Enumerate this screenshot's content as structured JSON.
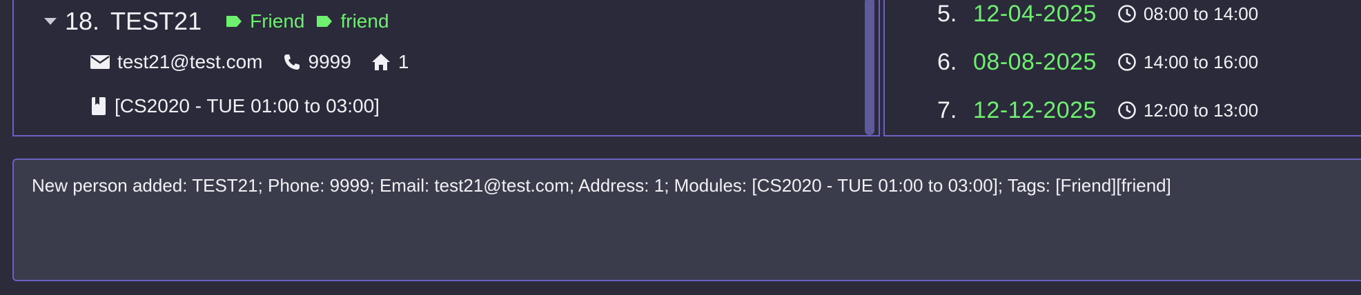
{
  "person": {
    "index": "18.",
    "name": "TEST21",
    "tags": [
      "Friend",
      "friend"
    ],
    "email": "test21@test.com",
    "phone": "9999",
    "address": "1",
    "module": "[CS2020 - TUE 01:00 to 03:00]"
  },
  "appointments": [
    {
      "num": "5.",
      "date": "12-04-2025",
      "time": "08:00 to 14:00"
    },
    {
      "num": "6.",
      "date": "08-08-2025",
      "time": "14:00 to 16:00"
    },
    {
      "num": "7.",
      "date": "12-12-2025",
      "time": "12:00 to 13:00"
    }
  ],
  "result_message": "New person added: TEST21; Phone: 9999; Email: test21@test.com; Address: 1; Modules: [CS2020 - TUE 01:00 to 03:00]; Tags: [Friend][friend]",
  "colors": {
    "accent": "#6a62c4",
    "tag_green": "#6fef6f",
    "background": "#2a2a3b"
  },
  "icons": [
    "caret-down-icon",
    "tag-icon",
    "mail-icon",
    "phone-icon",
    "home-icon",
    "book-icon",
    "clock-icon"
  ]
}
